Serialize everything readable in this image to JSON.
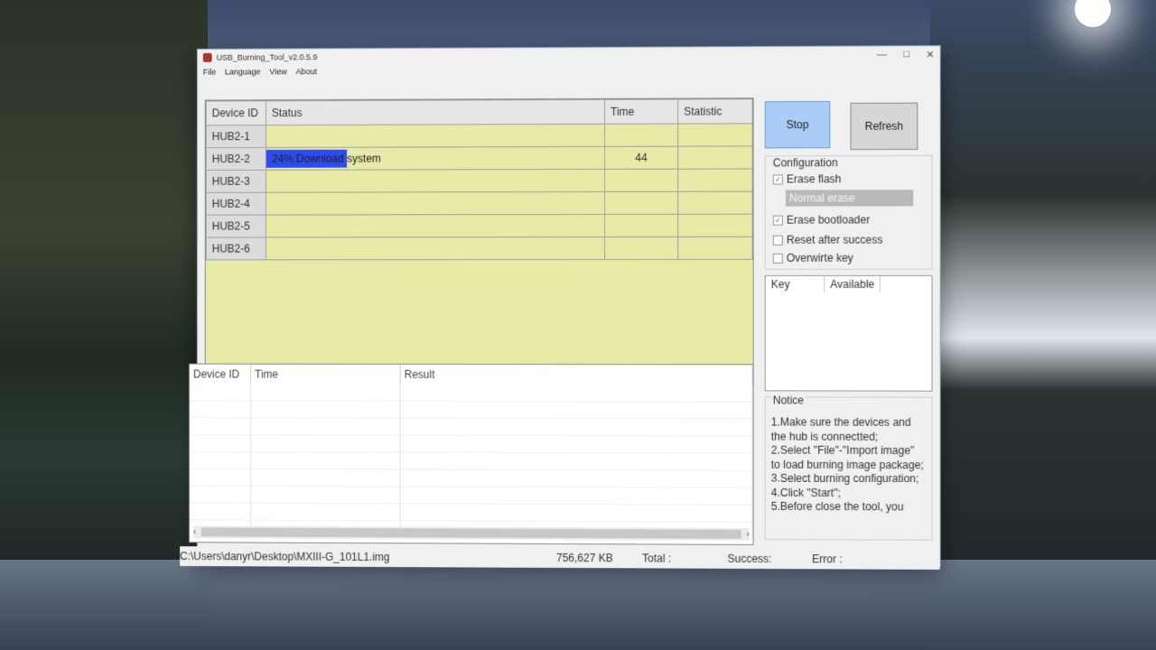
{
  "window": {
    "title": "USB_Burning_Tool_v2.0.5.9",
    "controls": [
      "—",
      "□",
      "✕"
    ]
  },
  "menu": [
    "File",
    "Language",
    "View",
    "About"
  ],
  "grid": {
    "headers": [
      "Device ID",
      "Status",
      "Time",
      "Statistic"
    ],
    "rows": [
      {
        "id": "HUB2-1",
        "status": "",
        "time": "",
        "statistic": ""
      },
      {
        "id": "HUB2-2",
        "status": "24%:Download system",
        "time": "44",
        "statistic": "",
        "progress": 0.24
      },
      {
        "id": "HUB2-3",
        "status": "",
        "time": "",
        "statistic": ""
      },
      {
        "id": "HUB2-4",
        "status": "",
        "time": "",
        "statistic": ""
      },
      {
        "id": "HUB2-5",
        "status": "",
        "time": "",
        "statistic": ""
      },
      {
        "id": "HUB2-6",
        "status": "",
        "time": "",
        "statistic": ""
      }
    ]
  },
  "log": {
    "headers": [
      "Device ID",
      "Time",
      "Result"
    ]
  },
  "scroll": {
    "left": "‹",
    "right": "›"
  },
  "buttons": {
    "stop": "Stop",
    "refresh": "Refresh"
  },
  "config": {
    "title": "Configuration",
    "erase_flash": {
      "label": "Erase flash",
      "checked": true
    },
    "erase_mode": "Normal erase",
    "erase_bootloader": {
      "label": "Erase bootloader",
      "checked": true
    },
    "reset_after_success": {
      "label": "Reset after success",
      "checked": false
    },
    "overwrite_key": {
      "label": "Overwirte key",
      "checked": false
    }
  },
  "keys": {
    "headers": [
      "Key",
      "Available"
    ]
  },
  "notice": {
    "title": "Notice",
    "text": "1.Make sure the devices and the hub is connectted;\n2.Select \"File\"-\"Import image\" to load burning image package;\n3.Select burning configuration;\n4.Click \"Start\";\n5.Before close the tool, you"
  },
  "statusbar": {
    "path": "C:\\Users\\danyr\\Desktop\\MXIII-G_101L1.img",
    "size": "756,627 KB",
    "total": "Total :",
    "success": "Success:",
    "error": "Error :"
  },
  "colors": {
    "grid_bg": "#e8eaa8",
    "progress": "#2d4cf0",
    "stop_button": "#a9cdf6"
  }
}
